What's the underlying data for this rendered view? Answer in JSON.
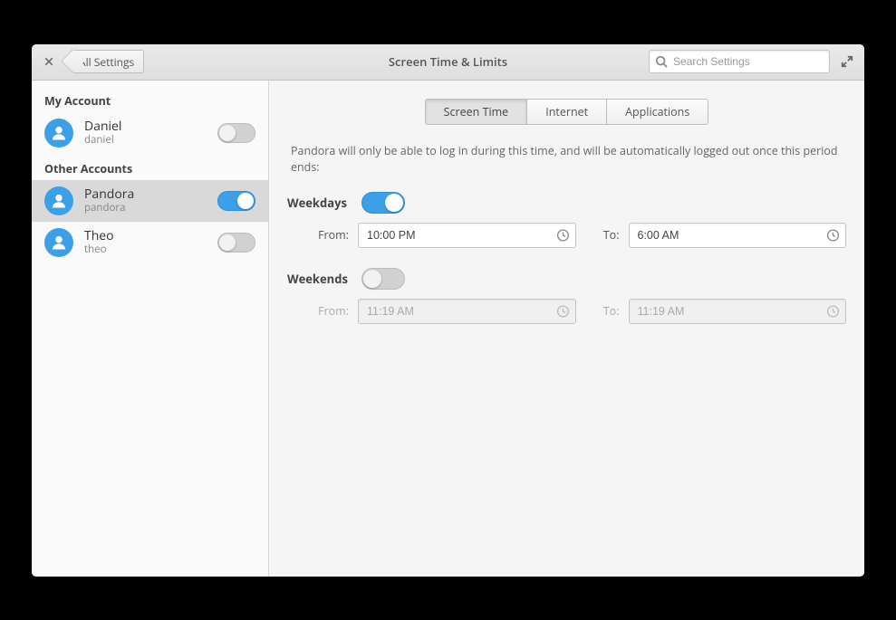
{
  "header": {
    "title": "Screen Time & Limits",
    "back_label": "All Settings",
    "search_placeholder": "Search Settings"
  },
  "sidebar": {
    "my_account_label": "My Account",
    "other_accounts_label": "Other Accounts",
    "my_account": {
      "display_name": "Daniel",
      "username": "daniel",
      "toggled": false
    },
    "other_accounts": [
      {
        "display_name": "Pandora",
        "username": "pandora",
        "toggled": true,
        "selected": true
      },
      {
        "display_name": "Theo",
        "username": "theo",
        "toggled": false,
        "selected": false
      }
    ]
  },
  "tabs": [
    {
      "label": "Screen Time",
      "active": true
    },
    {
      "label": "Internet",
      "active": false
    },
    {
      "label": "Applications",
      "active": false
    }
  ],
  "main": {
    "description": "Pandora will only be able to log in during this time, and will be automatically logged out once this period ends:",
    "weekdays": {
      "label": "Weekdays",
      "enabled": true,
      "from_label": "From:",
      "to_label": "To:",
      "from_value": "10:00 PM",
      "to_value": "6:00 AM"
    },
    "weekends": {
      "label": "Weekends",
      "enabled": false,
      "from_label": "From:",
      "to_label": "To:",
      "from_value": "11:19 AM",
      "to_value": "11:19 AM"
    }
  }
}
